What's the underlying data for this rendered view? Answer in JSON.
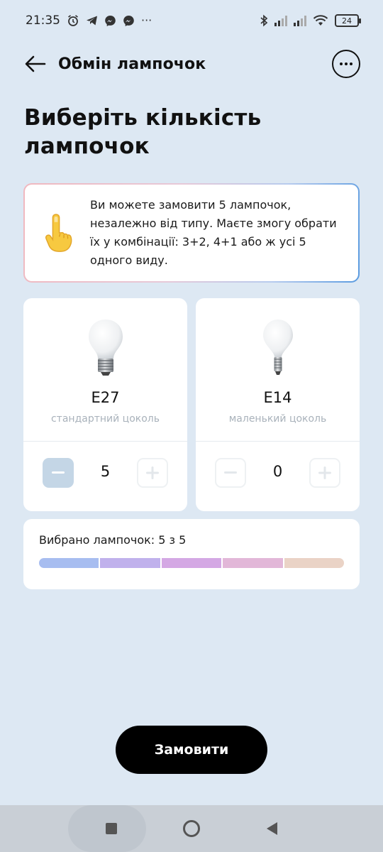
{
  "status_bar": {
    "time": "21:35",
    "battery": "24",
    "left_icons": [
      "alarm-icon",
      "telegram-icon",
      "messenger-icon",
      "messenger-icon",
      "more-dots-icon"
    ],
    "right_icons": [
      "bluetooth-icon",
      "signal-icon",
      "signal-icon",
      "wifi-icon",
      "battery-icon"
    ]
  },
  "header": {
    "title": "Обмін лампочок"
  },
  "page_title": "Виберіть кількість лампочок",
  "info": {
    "icon": "pointing-finger-icon",
    "text": "Ви можете замовити 5 лампочок, незалежно від типу. Маєте змогу обрати їх у комбінації: 3+2, 4+1 або ж усі 5 одного виду."
  },
  "bulbs": [
    {
      "type": "E27",
      "description": "стандартний цоколь",
      "count": "5",
      "minus_enabled": true,
      "plus_enabled": false
    },
    {
      "type": "E14",
      "description": "маленький цоколь",
      "count": "0",
      "minus_enabled": false,
      "plus_enabled": false
    }
  ],
  "summary": {
    "text": "Вибрано лампочок: 5 з 5",
    "selected": 5,
    "total": 5,
    "segment_colors": [
      "#a7bdf0",
      "#c0b1ec",
      "#d4a8e4",
      "#e2b7d8",
      "#ead3c6"
    ]
  },
  "order_button": {
    "label": "Замовити"
  },
  "nav": {
    "icons": [
      "recents-square-icon",
      "home-circle-icon",
      "back-triangle-icon"
    ]
  }
}
